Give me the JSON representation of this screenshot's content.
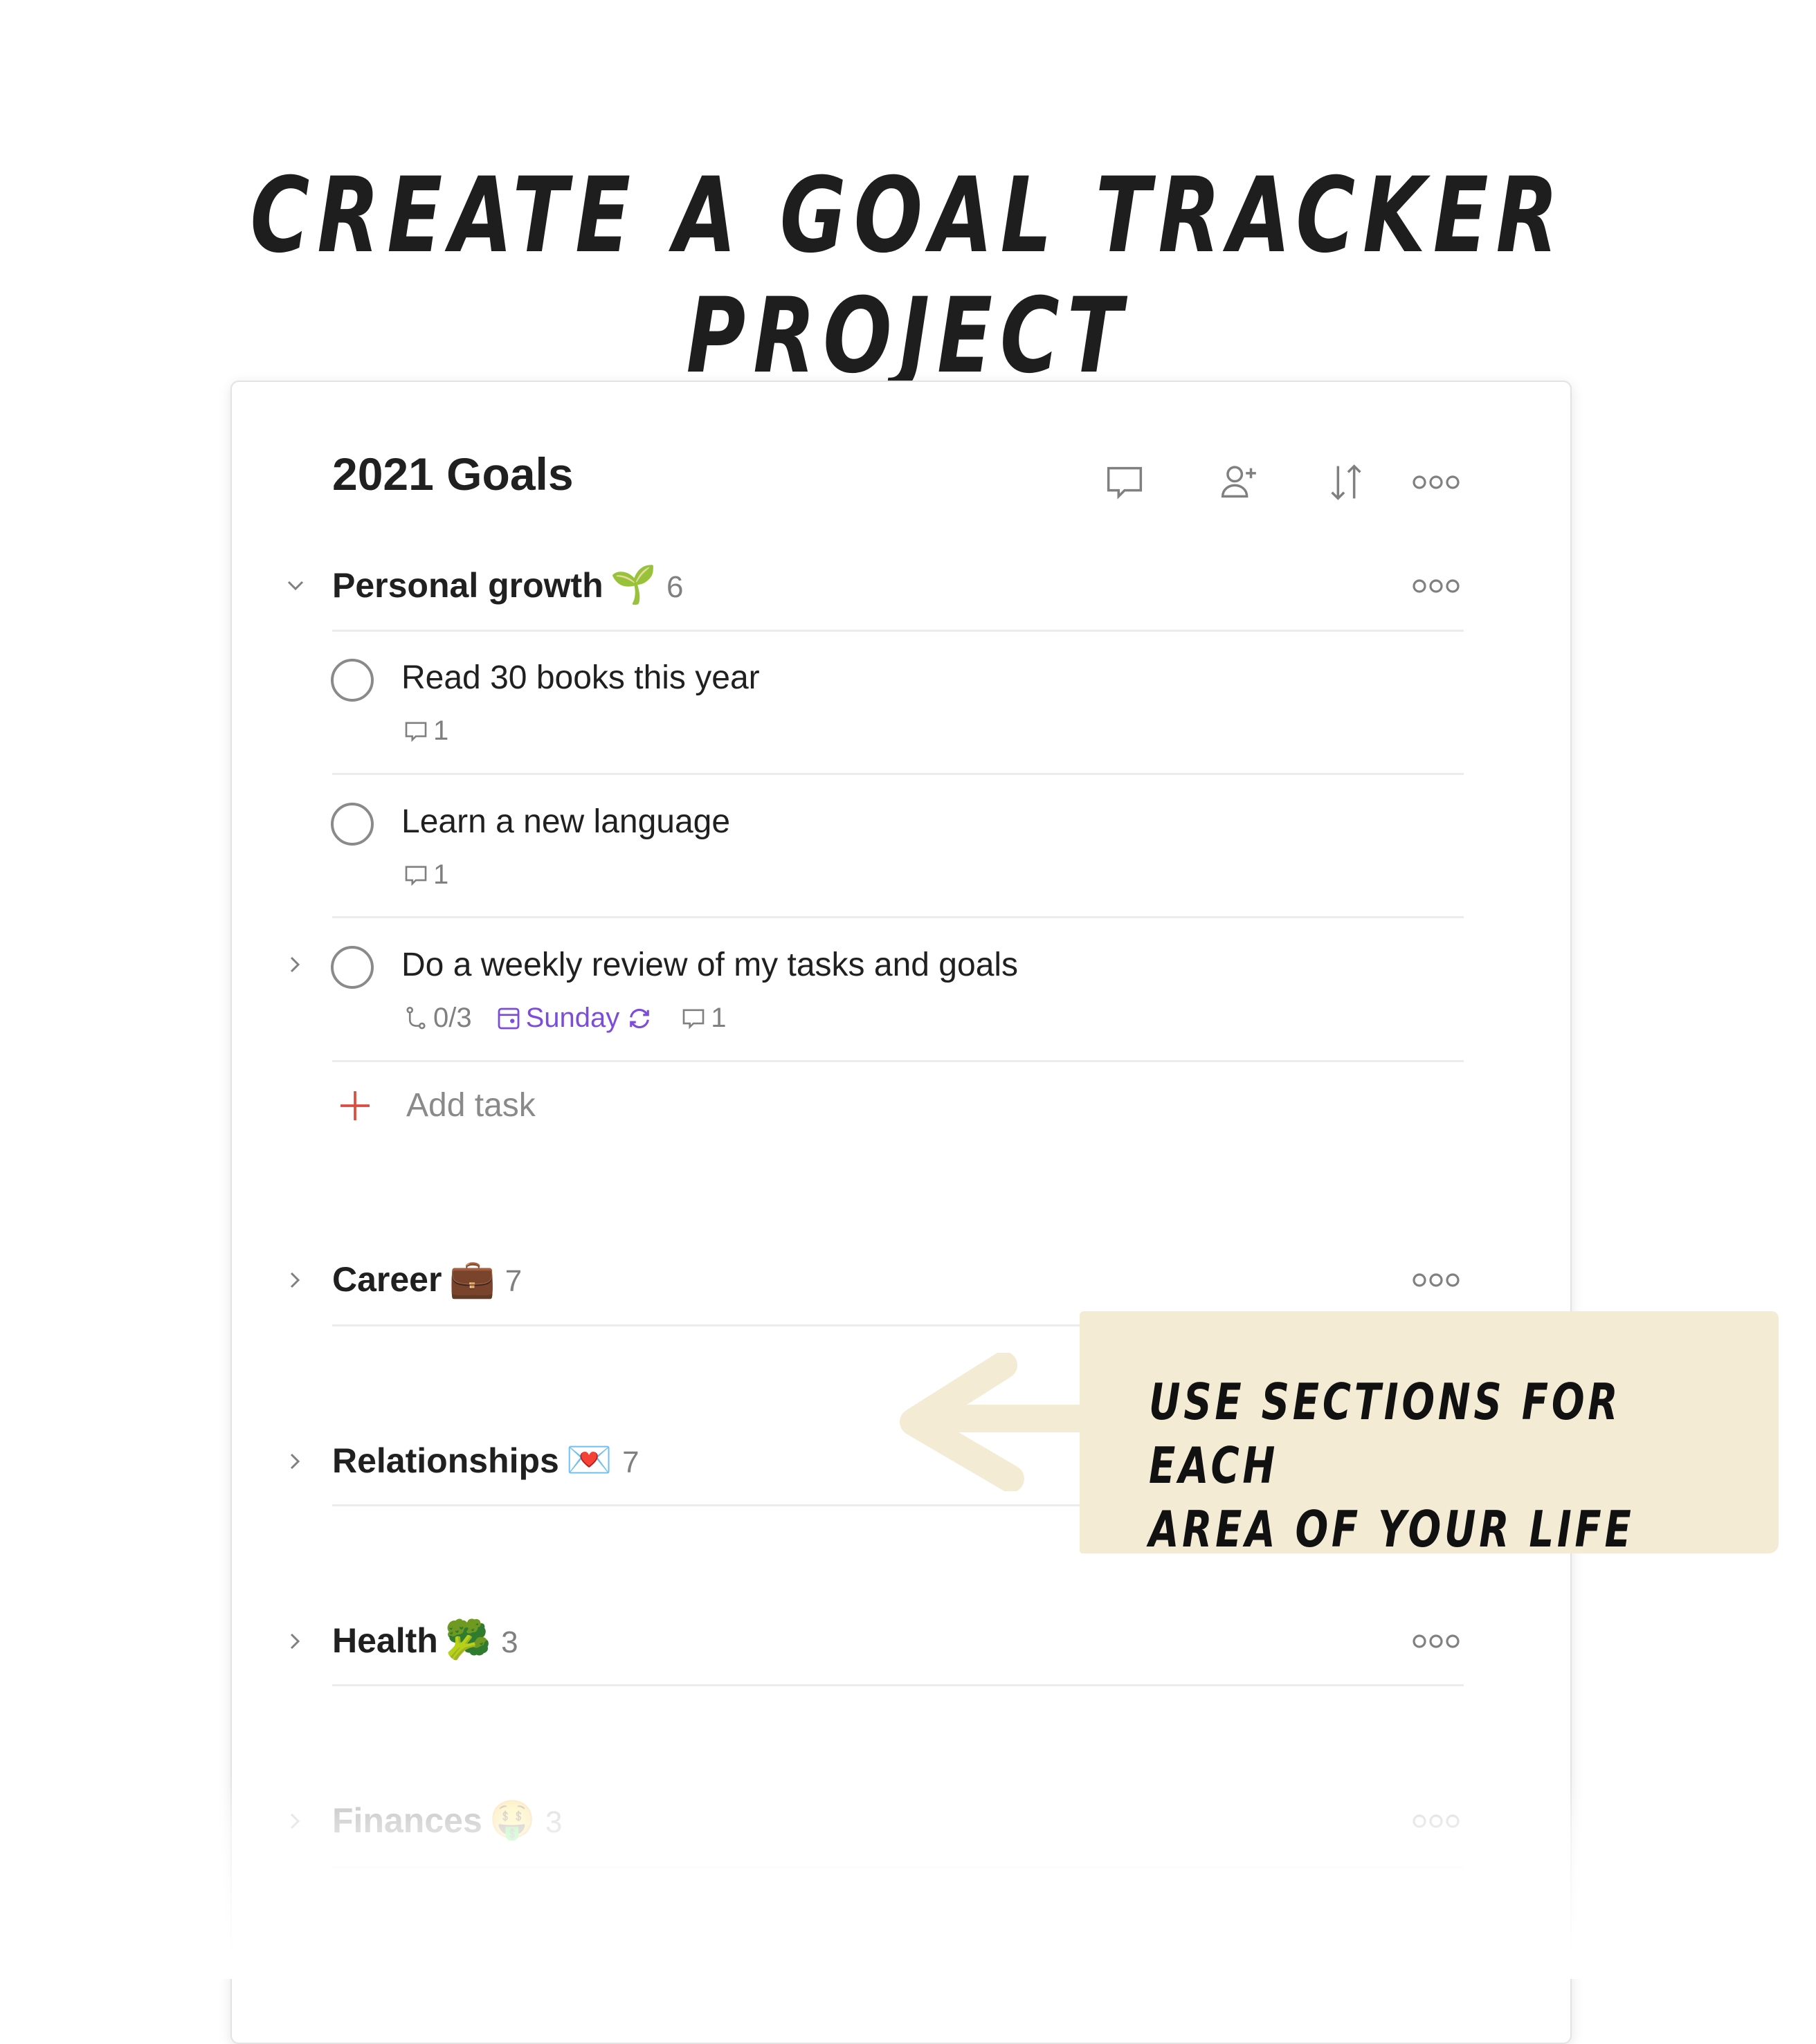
{
  "headline": "CREATE A GOAL TRACKER PROJECT",
  "project": {
    "title": "2021 Goals",
    "header_icons": [
      "comment-icon",
      "add-person-icon",
      "sort-icon",
      "more-icon"
    ]
  },
  "sections": [
    {
      "name": "Personal growth",
      "emoji": "🌱",
      "count": "6",
      "expanded": true,
      "tasks": [
        {
          "title": "Read 30 books this year",
          "comments": "1"
        },
        {
          "title": "Learn a new language",
          "comments": "1"
        },
        {
          "title": "Do a weekly review of my tasks and goals",
          "subtasks": "0/3",
          "due": "Sunday",
          "recurring": true,
          "comments": "1"
        }
      ],
      "add_task_label": "Add task"
    },
    {
      "name": "Career",
      "emoji": "💼",
      "count": "7",
      "expanded": false
    },
    {
      "name": "Relationships",
      "emoji": "💌",
      "count": "7",
      "expanded": false
    },
    {
      "name": "Health",
      "emoji": "🥦",
      "count": "3",
      "expanded": false
    },
    {
      "name": "Finances",
      "emoji": "🤑",
      "count": "3",
      "expanded": false
    }
  ],
  "note": {
    "line1": "USE SECTIONS FOR EACH",
    "line2": "AREA OF YOUR LIFE"
  },
  "colors": {
    "accent_red": "#dc4c3e",
    "date_purple": "#7d4cdb",
    "note_background": "#f3ebd4"
  }
}
